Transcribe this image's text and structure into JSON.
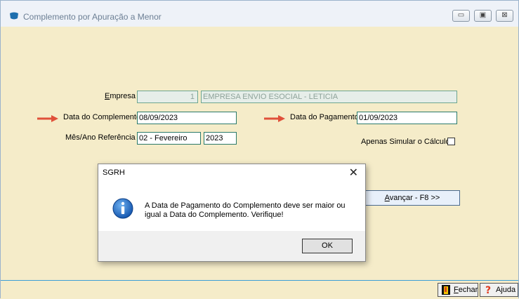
{
  "window": {
    "title": "Complemento por Apuração a Menor",
    "buttons": {
      "minimize": "▭",
      "maximize": "▣",
      "close": "⊠"
    }
  },
  "form": {
    "empresa": {
      "label_u": "E",
      "label_rest": "mpresa",
      "code": "1",
      "name": "EMPRESA ENVIO ESOCIAL - LETICIA"
    },
    "data_complemento": {
      "label": "Data do Complemento",
      "value": "08/09/2023"
    },
    "data_pagamento": {
      "label": "Data do Pagamento",
      "value": "01/09/2023"
    },
    "mes_ano": {
      "label": "Mês/Ano Referência",
      "month": "02 - Fevereiro",
      "year": "2023"
    },
    "simular": {
      "label": "Apenas Simular o Cálculo",
      "checked": false
    },
    "avancar": {
      "label_u": "A",
      "label_rest": "vançar - F8 >>"
    }
  },
  "bottom": {
    "fechar": {
      "label_u": "F",
      "label_rest": "echar"
    },
    "ajuda": {
      "label": "Ajuda"
    }
  },
  "dialog": {
    "title": "SGRH",
    "close": "✕",
    "message": "A Data de Pagamento do Complemento deve ser maior ou igual a Data do Complemento. Verifique!",
    "ok": "OK"
  },
  "colors": {
    "background": "#f5ecc9",
    "accent": "#3b9fd6",
    "arrow": "#e0503a"
  },
  "icons": {
    "title": "app-icon",
    "arrow": "red-arrow-icon",
    "info": "info-icon",
    "fechar": "exit-door-icon",
    "ajuda": "help-question-icon"
  }
}
